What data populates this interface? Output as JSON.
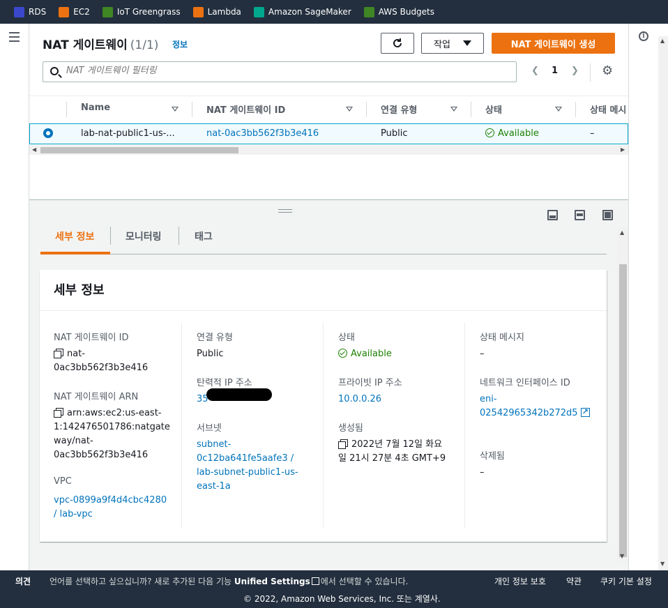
{
  "favorites": [
    {
      "label": "RDS",
      "color": "#3b48cc"
    },
    {
      "label": "EC2",
      "color": "#ec7211"
    },
    {
      "label": "IoT Greengrass",
      "color": "#3f8624"
    },
    {
      "label": "Lambda",
      "color": "#ec7211"
    },
    {
      "label": "Amazon SageMaker",
      "color": "#01a88d"
    },
    {
      "label": "AWS Budgets",
      "color": "#3f8624"
    }
  ],
  "panel": {
    "title": "NAT 게이트웨이",
    "count": "(1/1)",
    "info_link": "정보",
    "actions_label": "작업",
    "create_label": "NAT 게이트웨이 생성",
    "search_placeholder": "NAT 게이트웨이 필터링",
    "page_number": "1"
  },
  "table": {
    "columns": [
      "Name",
      "NAT 게이트웨이 ID",
      "연결 유형",
      "상태",
      "상태 메시"
    ],
    "rows": [
      {
        "name": "lab-nat-public1-us-...",
        "id": "nat-0ac3bb562f3b3e416",
        "connectivity": "Public",
        "state": "Available",
        "message": "–"
      }
    ]
  },
  "tabs": [
    "세부 정보",
    "모니터링",
    "태그"
  ],
  "details": {
    "title": "세부 정보",
    "nat_id_label": "NAT 게이트웨이 ID",
    "nat_id_line1": "nat-",
    "nat_id_line2": "0ac3bb562f3b3e416",
    "arn_label": "NAT 게이트웨이 ARN",
    "arn_line1": "arn:aws:ec2:us-east-",
    "arn_line2": "1:142476501786:natgate",
    "arn_line3": "way/nat-",
    "arn_line4": "0ac3bb562f3b3e416",
    "vpc_label": "VPC",
    "vpc_line1": "vpc-0899a9f4d4cbc4280",
    "vpc_line2": "/ lab-vpc",
    "conn_label": "연결 유형",
    "conn_value": "Public",
    "eip_label": "탄력적 IP 주소",
    "eip_value": "35",
    "subnet_label": "서브넷",
    "subnet_line1": "subnet-",
    "subnet_line2": "0c12ba641fe5aafe3 /",
    "subnet_line3": "lab-subnet-public1-us-",
    "subnet_line4": "east-1a",
    "state_label": "상태",
    "state_value": "Available",
    "private_ip_label": "프라이빗 IP 주소",
    "private_ip_value": "10.0.0.26",
    "created_label": "생성됨",
    "created_line1": "2022년 7월 12일 화요",
    "created_line2": "일 21시 27분 4초 GMT+9",
    "msg_label": "상태 메시지",
    "msg_value": "–",
    "eni_label": "네트워크 인터페이스 ID",
    "eni_line1": "eni-",
    "eni_line2": "02542965342b272d5",
    "deleted_label": "삭제됨",
    "deleted_value": "–"
  },
  "footer": {
    "feedback": "의견",
    "lang_prefix": "언어를 선택하고 싶으십니까? 새로 추가된 다음 기능 ",
    "unified_settings": "Unified Settings",
    "lang_suffix": "에서 선택할 수 있습니다.",
    "privacy": "개인 정보 보호",
    "terms": "약관",
    "cookies": "쿠키 기본 설정",
    "copyright": "© 2022, Amazon Web Services, Inc. 또는 계열사."
  },
  "colors": {
    "accent": "#ec7211",
    "link": "#0073bb",
    "success": "#1d8102",
    "header": "#232f3e"
  }
}
